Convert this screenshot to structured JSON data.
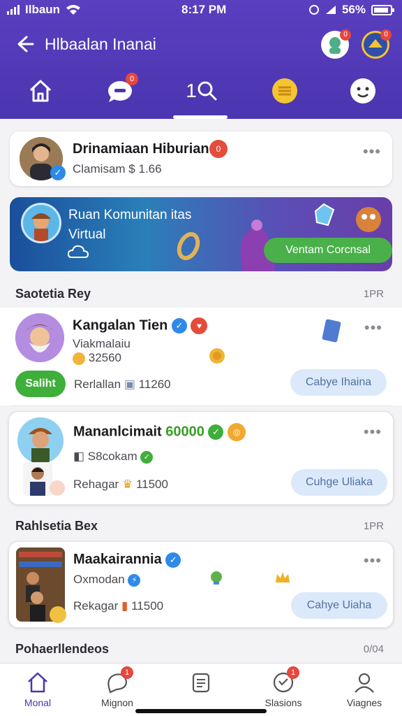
{
  "status_bar": {
    "carrier": "Ilbaun",
    "time": "8:17 PM",
    "battery": "56%"
  },
  "header": {
    "title": "Hlbaalan Inanai",
    "tabs": [
      {
        "name": "home",
        "badge": ""
      },
      {
        "name": "chat",
        "badge": "0"
      },
      {
        "name": "search",
        "label": "1"
      },
      {
        "name": "menu",
        "badge": ""
      },
      {
        "name": "profile",
        "badge": ""
      }
    ]
  },
  "profile_card": {
    "name": "Drinamiaan Hiburian",
    "badge": "0",
    "sub": "Clamisam",
    "sub_value": "1.66"
  },
  "banner": {
    "title": "Ruan Komunitan itas Virtual",
    "button": "Ventam Corcnsal"
  },
  "sections": [
    {
      "title": "Saotetia Rey",
      "time": "1PR"
    },
    {
      "title": "Rahlsetia Bex",
      "time": "1PR"
    },
    {
      "title": "Pohaerllendeos",
      "time": "0/04"
    }
  ],
  "posts": [
    {
      "name": "Kangalan Tien",
      "line1": "Viakmalaiu",
      "line2": "32560",
      "status_btn": "Saliht",
      "meta_label": "Rerlallan",
      "meta_value": "11260",
      "action": "Cabye Ihaina"
    },
    {
      "name": "Mananlcimait",
      "name_extra": "60000",
      "line1": "S8cokam",
      "meta_label": "Rehagar",
      "meta_value": "11500",
      "action": "Cuhge Uliaka"
    },
    {
      "name": "Maakairannia",
      "line1": "Oxmodan",
      "meta_label": "Rekagar",
      "meta_value": "11500",
      "action": "Cahye Uiaha"
    }
  ],
  "bottom_nav": [
    {
      "label": "Monal",
      "badge": ""
    },
    {
      "label": "Mignon",
      "badge": "1"
    },
    {
      "label": "",
      "badge": ""
    },
    {
      "label": "Slasions",
      "badge": "1"
    },
    {
      "label": "Viagnes",
      "badge": ""
    }
  ]
}
